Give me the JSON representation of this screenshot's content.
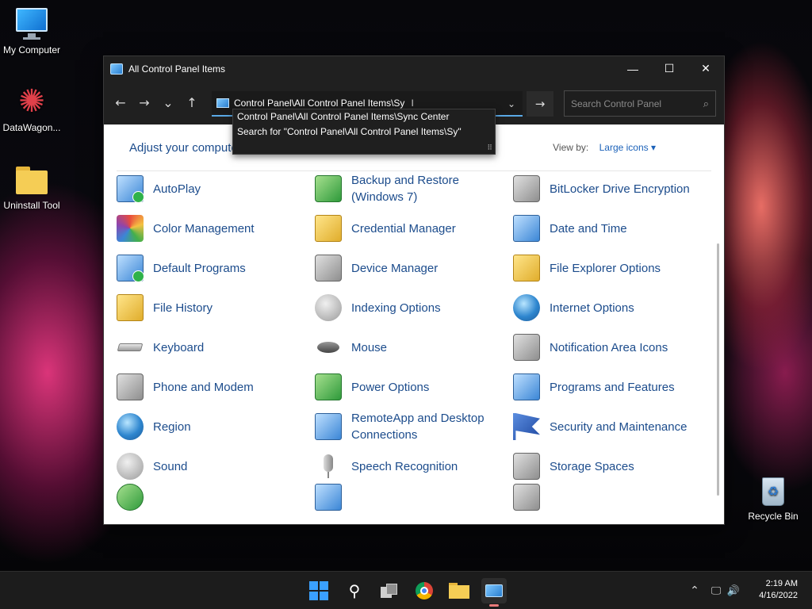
{
  "desktop": {
    "icons": [
      {
        "label": "My Computer"
      },
      {
        "label": "DataWagon..."
      },
      {
        "label": "Uninstall Tool"
      },
      {
        "label": "Recycle Bin"
      }
    ]
  },
  "window": {
    "title": "All Control Panel Items",
    "controls": {
      "minimize": "—",
      "maximize": "☐",
      "close": "✕"
    },
    "nav": {
      "back": "←",
      "forward": "→",
      "recent": "⌄",
      "up": "↑"
    },
    "address": {
      "value": "Control Panel\\All Control Panel Items\\Sy",
      "go": "→",
      "dropdown": "⌄"
    },
    "search": {
      "placeholder": "Search Control Panel",
      "icon": "⌕"
    },
    "autocomplete": [
      "Control Panel\\All Control Panel Items\\Sync Center",
      "Search for \"Control Panel\\All Control Panel Items\\Sy\""
    ],
    "heading": "Adjust your computer's settings",
    "view_by": {
      "label": "View by:",
      "value": "Large icons ▾"
    },
    "items": [
      {
        "label": "AutoPlay",
        "icon": "autoplay-icon"
      },
      {
        "label": "Backup and Restore (Windows 7)",
        "icon": "backup-icon"
      },
      {
        "label": "BitLocker Drive Encryption",
        "icon": "bitlocker-icon"
      },
      {
        "label": "Color Management",
        "icon": "color-management-icon"
      },
      {
        "label": "Credential Manager",
        "icon": "credential-icon"
      },
      {
        "label": "Date and Time",
        "icon": "calendar-icon"
      },
      {
        "label": "Default Programs",
        "icon": "default-programs-icon"
      },
      {
        "label": "Device Manager",
        "icon": "device-manager-icon"
      },
      {
        "label": "File Explorer Options",
        "icon": "folder-options-icon"
      },
      {
        "label": "File History",
        "icon": "file-history-icon"
      },
      {
        "label": "Indexing Options",
        "icon": "indexing-icon"
      },
      {
        "label": "Internet Options",
        "icon": "globe-icon"
      },
      {
        "label": "Keyboard",
        "icon": "keyboard-icon"
      },
      {
        "label": "Mouse",
        "icon": "mouse-icon"
      },
      {
        "label": "Notification Area Icons",
        "icon": "notification-icon"
      },
      {
        "label": "Phone and Modem",
        "icon": "phone-icon"
      },
      {
        "label": "Power Options",
        "icon": "power-icon"
      },
      {
        "label": "Programs and Features",
        "icon": "programs-icon"
      },
      {
        "label": "Region",
        "icon": "region-icon"
      },
      {
        "label": "RemoteApp and Desktop Connections",
        "icon": "remoteapp-icon"
      },
      {
        "label": "Security and Maintenance",
        "icon": "flag-icon"
      },
      {
        "label": "Sound",
        "icon": "speaker-icon"
      },
      {
        "label": "Speech Recognition",
        "icon": "microphone-icon"
      },
      {
        "label": "Storage Spaces",
        "icon": "storage-icon"
      }
    ]
  },
  "taskbar": {
    "clock": {
      "time": "2:19 AM",
      "date": "4/16/2022"
    },
    "tray": {
      "chevron": "⌃",
      "network": "🖵",
      "volume": "🔊"
    }
  }
}
